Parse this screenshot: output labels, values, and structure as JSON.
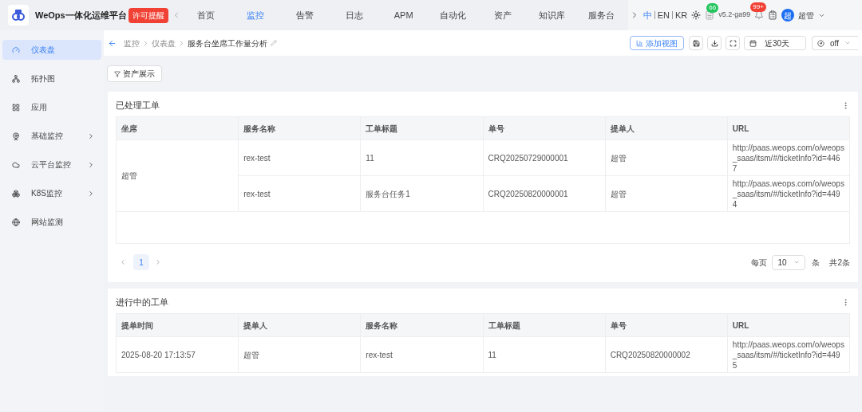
{
  "app": {
    "title": "WeOps一体化运维平台",
    "license_badge": "许可提醒"
  },
  "nav": [
    {
      "label": "首页",
      "selected": false
    },
    {
      "label": "监控",
      "selected": true
    },
    {
      "label": "告警",
      "selected": false
    },
    {
      "label": "日志",
      "selected": false
    },
    {
      "label": "APM",
      "selected": false
    },
    {
      "label": "自动化",
      "selected": false
    },
    {
      "label": "资产",
      "selected": false
    },
    {
      "label": "知识库",
      "selected": false
    },
    {
      "label": "服务台",
      "selected": false
    }
  ],
  "languages": [
    {
      "label": "中",
      "selected": true
    },
    {
      "label": "EN",
      "selected": false
    },
    {
      "label": "KR",
      "selected": false
    }
  ],
  "message_count": "66",
  "version": "v5.2-ga99",
  "notification_count": "99+",
  "user": {
    "avatar": "超",
    "name": "超管"
  },
  "sidebar": [
    {
      "label": "仪表盘",
      "selected": true,
      "expandable": false
    },
    {
      "label": "拓扑图",
      "selected": false,
      "expandable": false
    },
    {
      "label": "应用",
      "selected": false,
      "expandable": false
    },
    {
      "label": "基础监控",
      "selected": false,
      "expandable": true
    },
    {
      "label": "云平台监控",
      "selected": false,
      "expandable": true
    },
    {
      "label": "K8S监控",
      "selected": false,
      "expandable": true
    },
    {
      "label": "网站监测",
      "selected": false,
      "expandable": false
    }
  ],
  "breadcrumb": [
    "监控",
    "仪表盘",
    "服务台坐席工作量分析"
  ],
  "toolbar": {
    "add_view": "添加视图",
    "time_range": "近30天",
    "refresh": "off"
  },
  "filter_button": "资产展示",
  "processed": {
    "title": "已处理工单",
    "columns": [
      "坐席",
      "服务名称",
      "工单标题",
      "单号",
      "提单人",
      "URL"
    ],
    "groups": [
      {
        "seat": "超管",
        "rows": [
          {
            "service": "rex-test",
            "title": "11",
            "number": "CRQ20250729000001",
            "submitter": "超管",
            "url": "http://paas.weops.com/o/weops_saas/itsm/#/ticketInfo?id=4467"
          },
          {
            "service": "rex-test",
            "title": "服务台任务1",
            "number": "CRQ20250820000001",
            "submitter": "超管",
            "url": "http://paas.weops.com/o/weops_saas/itsm/#/ticketInfo?id=4494"
          }
        ]
      }
    ],
    "pagination": {
      "pages": [
        {
          "label": "1",
          "selected": true
        }
      ],
      "per_page_label": "每页",
      "per_page": "10",
      "unit": "条",
      "total": "共2条"
    }
  },
  "in_progress": {
    "title": "进行中的工单",
    "columns": [
      "提单时间",
      "提单人",
      "服务名称",
      "工单标题",
      "单号",
      "URL"
    ],
    "rows": [
      [
        "2025-08-20 17:13:57",
        "超管",
        "rex-test",
        "11",
        "CRQ20250820000002",
        "http://paas.weops.com/o/weops_saas/itsm/#/ticketInfo?id=4495"
      ]
    ]
  }
}
